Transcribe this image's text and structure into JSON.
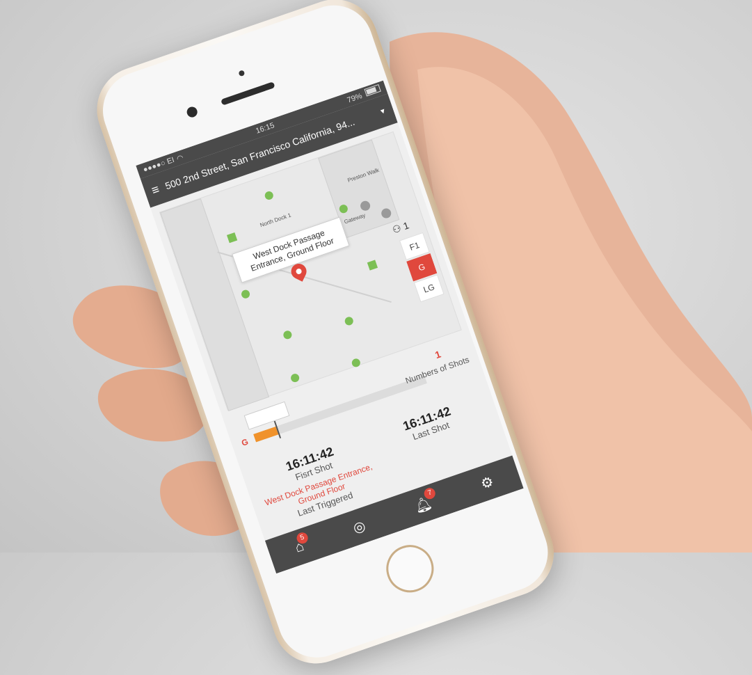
{
  "status_bar": {
    "carrier": "●●●●○ EI",
    "time": "16:15",
    "battery": "79%"
  },
  "header": {
    "menu_icon": "hamburger-icon",
    "address": "500 2nd Street, San Francisco California, 94..."
  },
  "map": {
    "labels": {
      "north_dock": "North Dock 1",
      "west_dock_passage": "West Dock Passage",
      "gateway": "Gateway",
      "preston_walk": "Preston Walk"
    },
    "popup": "West Dock Passage Entrance, Ground Floor",
    "floors": [
      "F1",
      "G",
      "LG"
    ],
    "active_floor": "G",
    "floor_indicator": "1"
  },
  "timeline": {
    "floor": "G",
    "shots_count": "1",
    "shots_label": "Numbers of Shots",
    "progress": 0.13
  },
  "stats": {
    "first_time": "16:11:42",
    "first_label": "Fisrt Shot",
    "last_time": "16:11:42",
    "last_label": "Last Shot",
    "triggered_location": "West Dock Passage Entrance, Ground Floor",
    "triggered_label": "Last Triggered"
  },
  "tabs": {
    "home_badge": "5",
    "alerts_badge": "7"
  },
  "colors": {
    "accent": "#e0483d",
    "header": "#4a4a4a",
    "marker": "#7cbf55",
    "progress": "#f0922b"
  }
}
